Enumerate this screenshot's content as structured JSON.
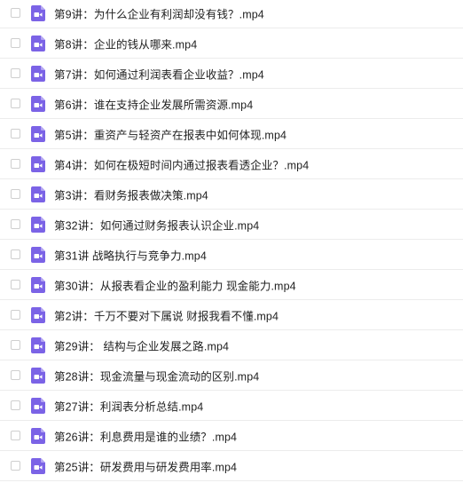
{
  "files": [
    {
      "name": "第9讲：为什么企业有利润却没有钱？.mp4",
      "icon": "video-file-icon"
    },
    {
      "name": "第8讲：企业的钱从哪来.mp4",
      "icon": "video-file-icon"
    },
    {
      "name": "第7讲：如何通过利润表看企业收益？.mp4",
      "icon": "video-file-icon"
    },
    {
      "name": "第6讲：谁在支持企业发展所需资源.mp4",
      "icon": "video-file-icon"
    },
    {
      "name": "第5讲：重资产与轻资产在报表中如何体现.mp4",
      "icon": "video-file-icon"
    },
    {
      "name": "第4讲：如何在极短时间内通过报表看透企业？.mp4",
      "icon": "video-file-icon"
    },
    {
      "name": "第3讲：看财务报表做决策.mp4",
      "icon": "video-file-icon"
    },
    {
      "name": "第32讲：如何通过财务报表认识企业.mp4",
      "icon": "video-file-icon"
    },
    {
      "name": "第31讲 战略执行与竞争力.mp4",
      "icon": "video-file-icon"
    },
    {
      "name": "第30讲：从报表看企业的盈利能力 现金能力.mp4",
      "icon": "video-file-icon"
    },
    {
      "name": "第2讲：千万不要对下属说 财报我看不懂.mp4",
      "icon": "video-file-icon"
    },
    {
      "name": "第29讲： 结构与企业发展之路.mp4",
      "icon": "video-file-icon"
    },
    {
      "name": "第28讲：现金流量与现金流动的区别.mp4",
      "icon": "video-file-icon"
    },
    {
      "name": "第27讲：利润表分析总结.mp4",
      "icon": "video-file-icon"
    },
    {
      "name": "第26讲：利息费用是谁的业绩？.mp4",
      "icon": "video-file-icon"
    },
    {
      "name": "第25讲：研发费用与研发费用率.mp4",
      "icon": "video-file-icon"
    }
  ],
  "colors": {
    "icon_purple": "#7b63e6",
    "icon_fold": "#b3a5f2",
    "text": "#222222",
    "divider": "#ececec"
  }
}
